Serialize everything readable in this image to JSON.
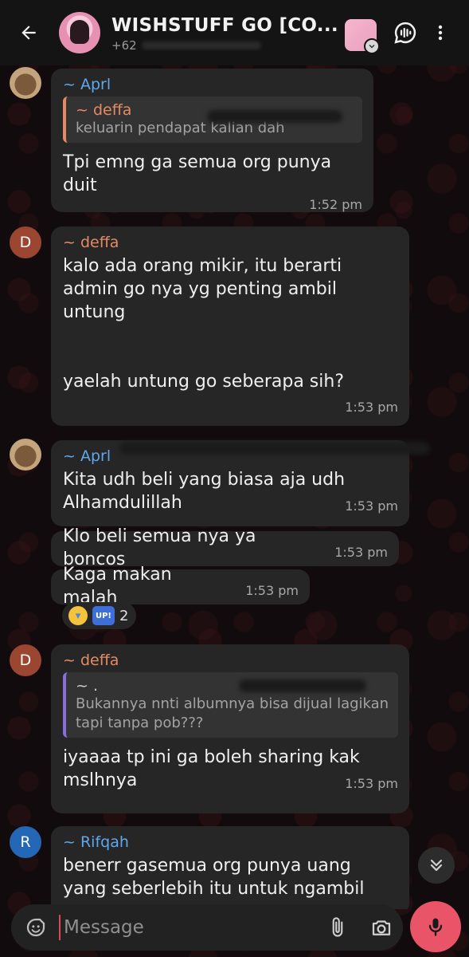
{
  "header": {
    "title": "WISHSTUFF GO [CO...",
    "subtitle": "+62"
  },
  "messages": [
    {
      "sender": "~ Aprl",
      "quote": {
        "name": "~ deffa",
        "text": "keluarin pendapat kalian dah"
      },
      "text": "Tpi emng ga semua org punya duit",
      "time": "1:52 pm"
    },
    {
      "sender": "~ deffa",
      "text": "kalo ada orang mikir, itu berarti admin go nya yg penting ambil untung",
      "text2": "yaelah untung go seberapa sih?",
      "time": "1:53 pm"
    },
    {
      "sender": "~ Aprl",
      "text": "Kita udh beli yang biasa aja udh Alhamdulillah",
      "time": "1:53 pm"
    },
    {
      "text": "Klo beli semua nya ya boncos",
      "time": "1:53 pm"
    },
    {
      "text": "Kaga makan malah",
      "time": "1:53 pm",
      "reaction_count": "2",
      "reaction_up": "UP!"
    },
    {
      "sender": "~ deffa",
      "quote": {
        "name": "~ .",
        "text": "Bukannya nnti albumnya bisa dijual lagikan tapi tanpa pob???"
      },
      "text": "iyaaaa tp ini ga boleh sharing kak mslhnya",
      "time": "1:53 pm"
    },
    {
      "sender": "~ Rifqah",
      "text": "benerr gasemua org punya uang yang seberlebih itu untuk ngambil sett"
    }
  ],
  "avatars": {
    "d_letter": "D",
    "r_letter": "R"
  },
  "input": {
    "placeholder": "Message"
  },
  "icons": [
    "back-arrow-icon",
    "voice-chat-icon",
    "more-vertical-icon",
    "emoji-icon",
    "attach-icon",
    "camera-icon",
    "mic-icon",
    "chevron-double-down-icon"
  ],
  "colors": {
    "accent_mic": "#ea5468",
    "sender_blue": "#5ea8ec",
    "sender_orange": "#e58a63"
  }
}
